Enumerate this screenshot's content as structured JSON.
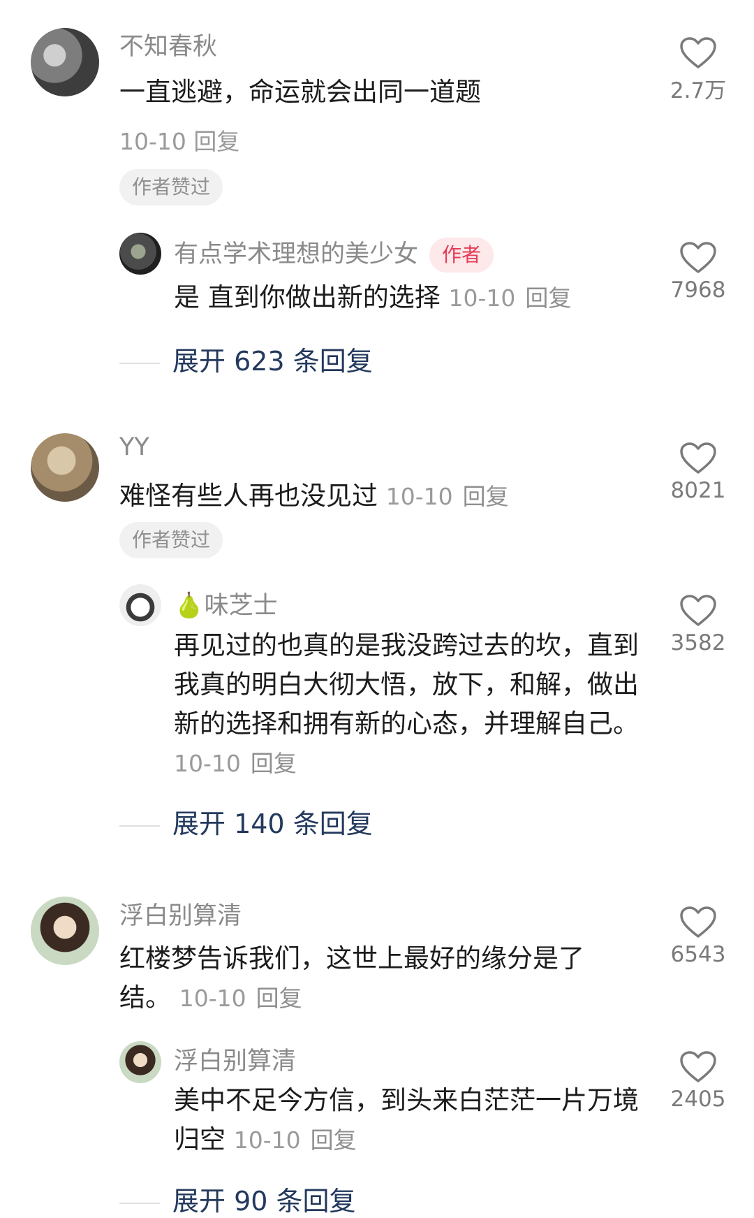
{
  "comments": [
    {
      "username": "不知春秋",
      "text": "一直逃避，命运就会出同一道题",
      "date": "10-10",
      "reply_label": "回复",
      "author_liked": "作者赞过",
      "likes": "2.7万",
      "replies": [
        {
          "username": "有点学术理想的美少女",
          "author_tag": "作者",
          "text": "是 直到你做出新的选择",
          "date": "10-10",
          "reply_label": "回复",
          "likes": "7968"
        }
      ],
      "expand_label": "展开 623 条回复"
    },
    {
      "username": "YY",
      "text": "难怪有些人再也没见过",
      "date": "10-10",
      "reply_label": "回复",
      "author_liked": "作者赞过",
      "likes": "8021",
      "replies": [
        {
          "username": "味芝士",
          "username_emoji": "🍐",
          "text": "再见过的也真的是我没跨过去的坎，直到我真的明白大彻大悟，放下，和解，做出新的选择和拥有新的心态，并理解自己。",
          "date": "10-10",
          "reply_label": "回复",
          "likes": "3582"
        }
      ],
      "expand_label": "展开 140 条回复"
    },
    {
      "username": "浮白别算清",
      "text": "红楼梦告诉我们，这世上最好的缘分是了结。",
      "date": "10-10",
      "reply_label": "回复",
      "likes": "6543",
      "replies": [
        {
          "username": "浮白别算清",
          "text": "美中不足今方信，到头来白茫茫一片万境归空",
          "date": "10-10",
          "reply_label": "回复",
          "likes": "2405"
        }
      ],
      "expand_label": "展开 90 条回复"
    }
  ],
  "avatar_palette": {
    "c1": "#6b6b6b",
    "c2": "#b9a48a",
    "c3": "#4a4a4a",
    "c4": "#6c7a5a"
  }
}
